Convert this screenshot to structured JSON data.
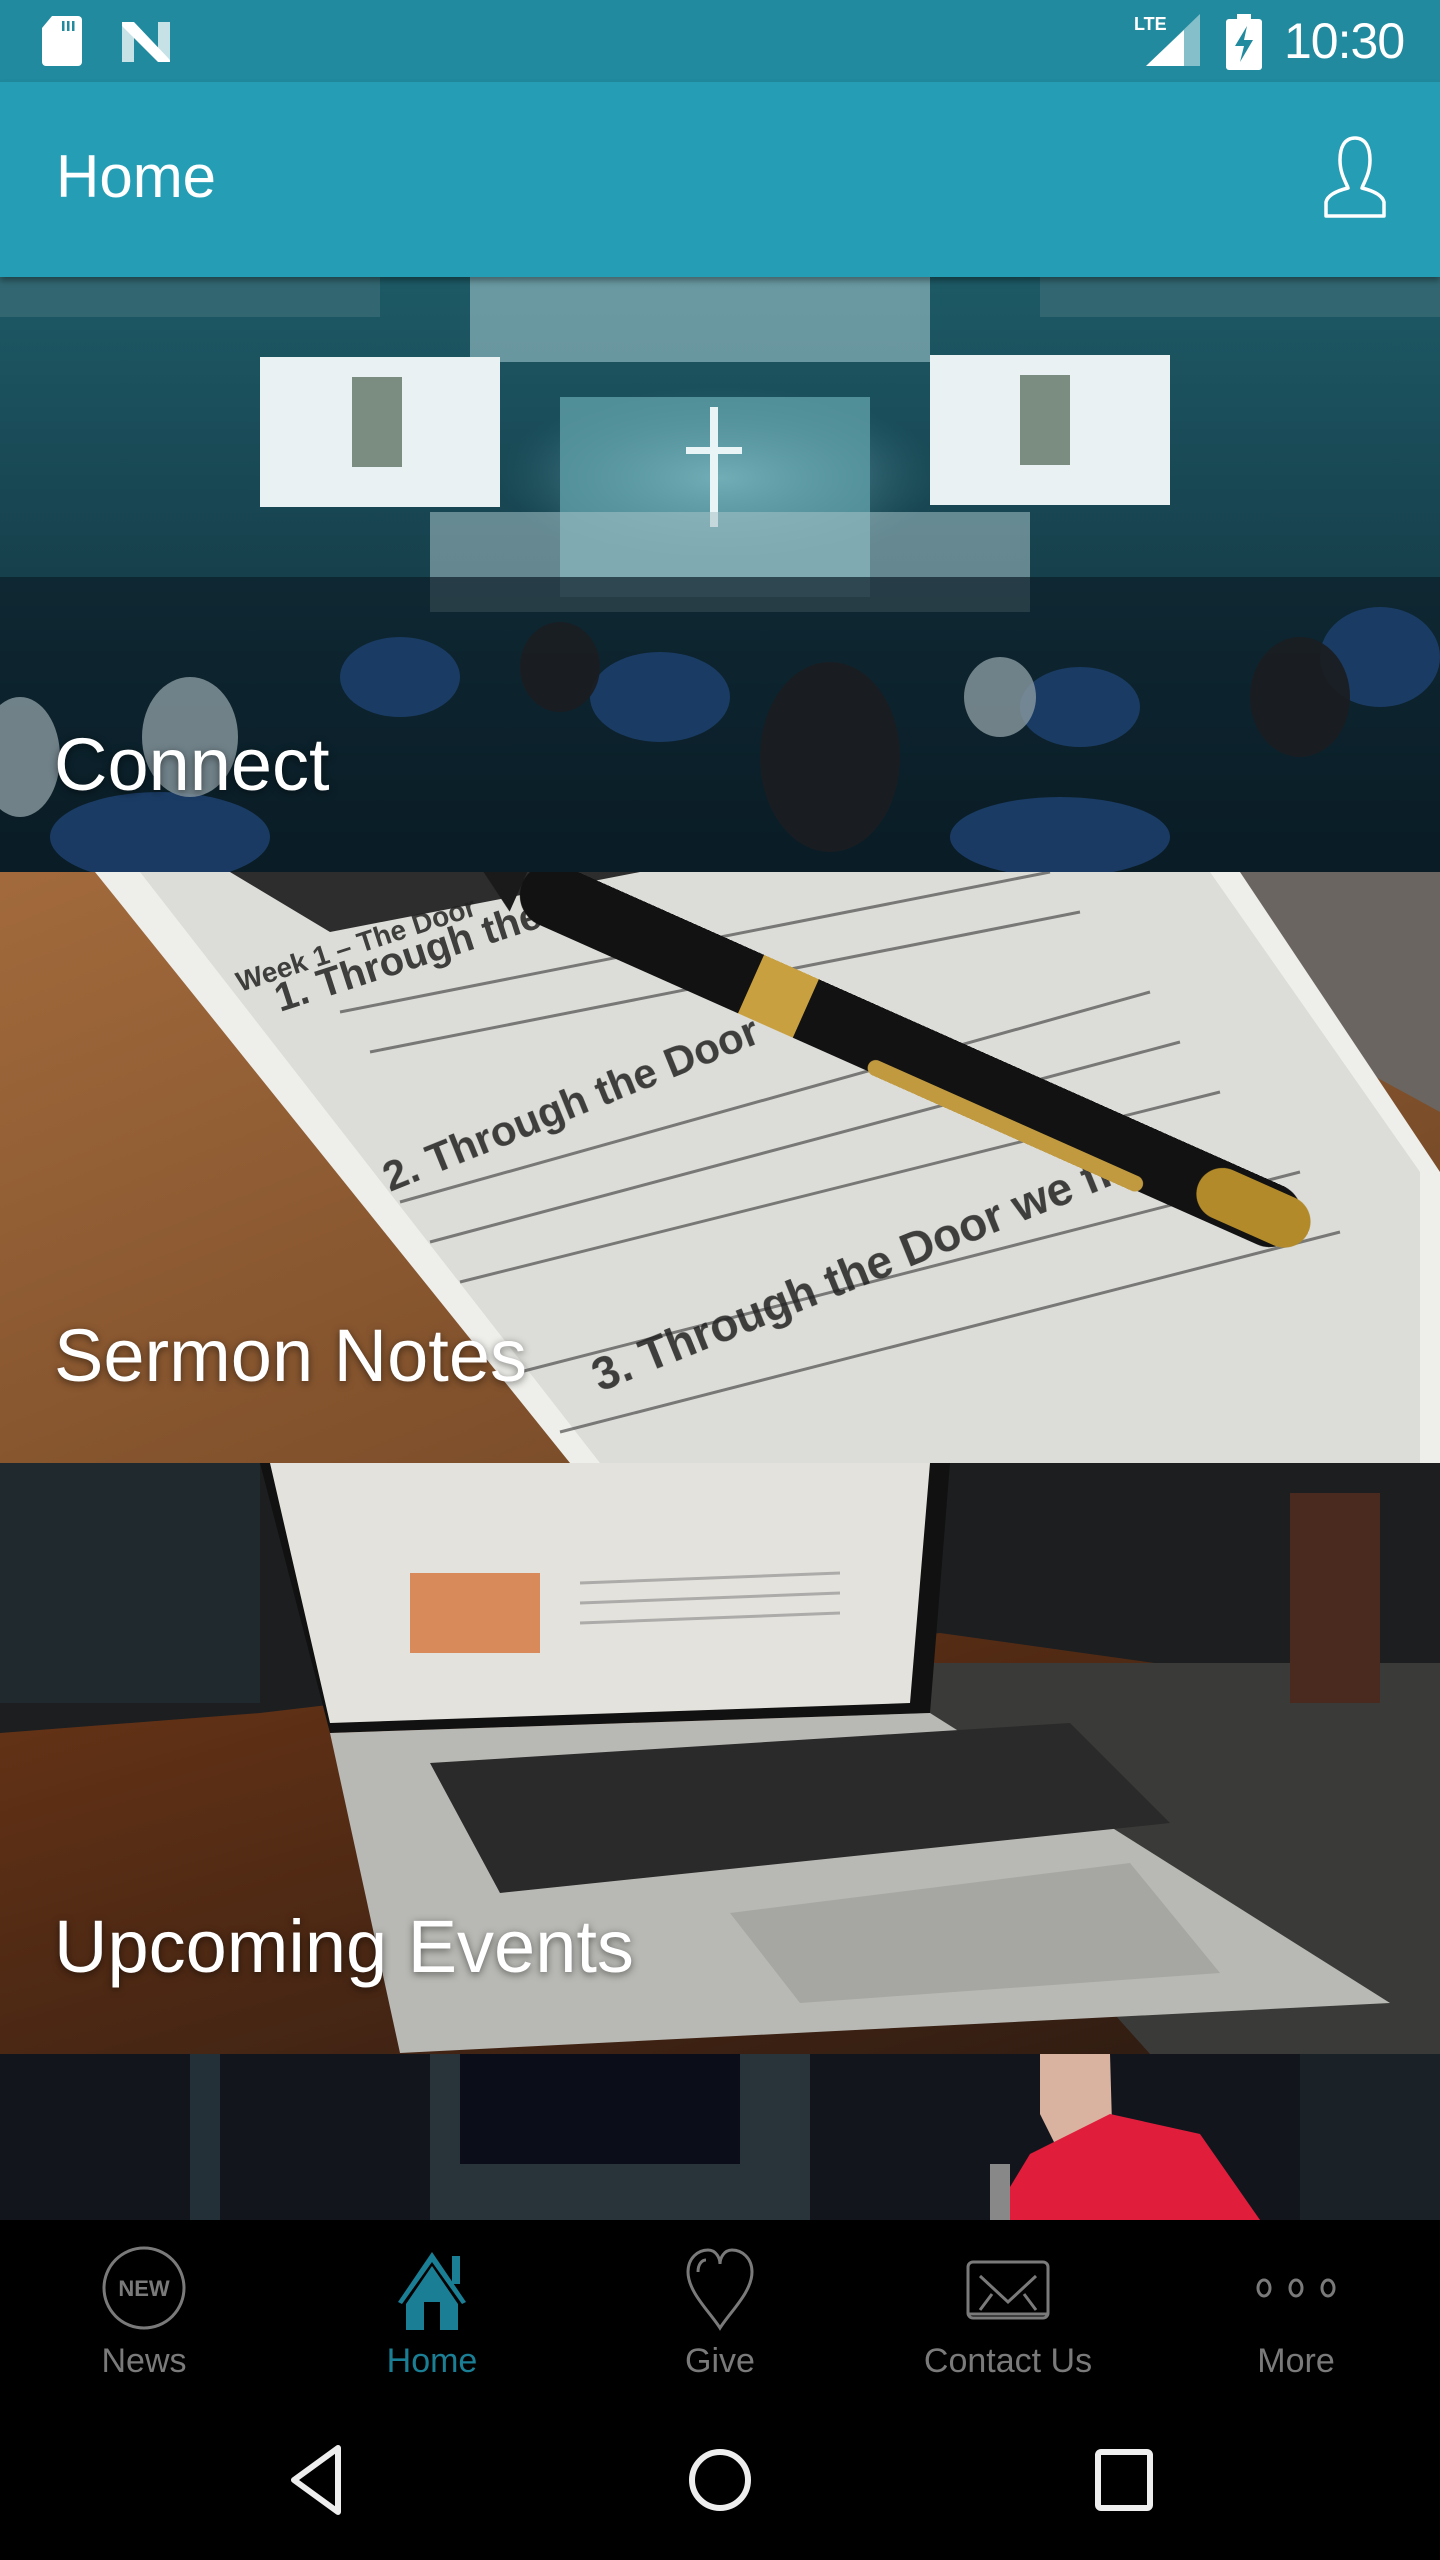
{
  "status_bar": {
    "time": "10:30",
    "left_icons": [
      "sd-card-icon",
      "n-notification-icon"
    ],
    "right_icons": [
      "lte-signal-icon",
      "battery-charging-icon"
    ],
    "network_label": "LTE"
  },
  "app_bar": {
    "title": "Home",
    "profile_icon": "user-profile-icon"
  },
  "cards": [
    {
      "label": "Connect",
      "image": "church-auditorium-congregation"
    },
    {
      "label": "Sermon Notes",
      "image": "pen-on-sermon-notes-sheet"
    },
    {
      "label": "Upcoming Events",
      "image": "laptop-events-page"
    },
    {
      "label": "",
      "image": "pastor-red-shirt-microphone"
    }
  ],
  "bottom_nav": {
    "active": "Home",
    "items": [
      {
        "label": "News",
        "icon": "new-badge-icon",
        "badge_text": "NEW"
      },
      {
        "label": "Home",
        "icon": "house-icon"
      },
      {
        "label": "Give",
        "icon": "heart-icon"
      },
      {
        "label": "Contact Us",
        "icon": "envelope-icon"
      },
      {
        "label": "More",
        "icon": "more-dots-icon"
      }
    ]
  },
  "system_nav": {
    "buttons": [
      "back",
      "home",
      "recents"
    ]
  },
  "colors": {
    "status_bar": "#218a9e",
    "app_bar": "#259eb5",
    "nav_active": "#1a7f95",
    "nav_inactive": "#7a7a7a",
    "nav_background": "#000000"
  }
}
